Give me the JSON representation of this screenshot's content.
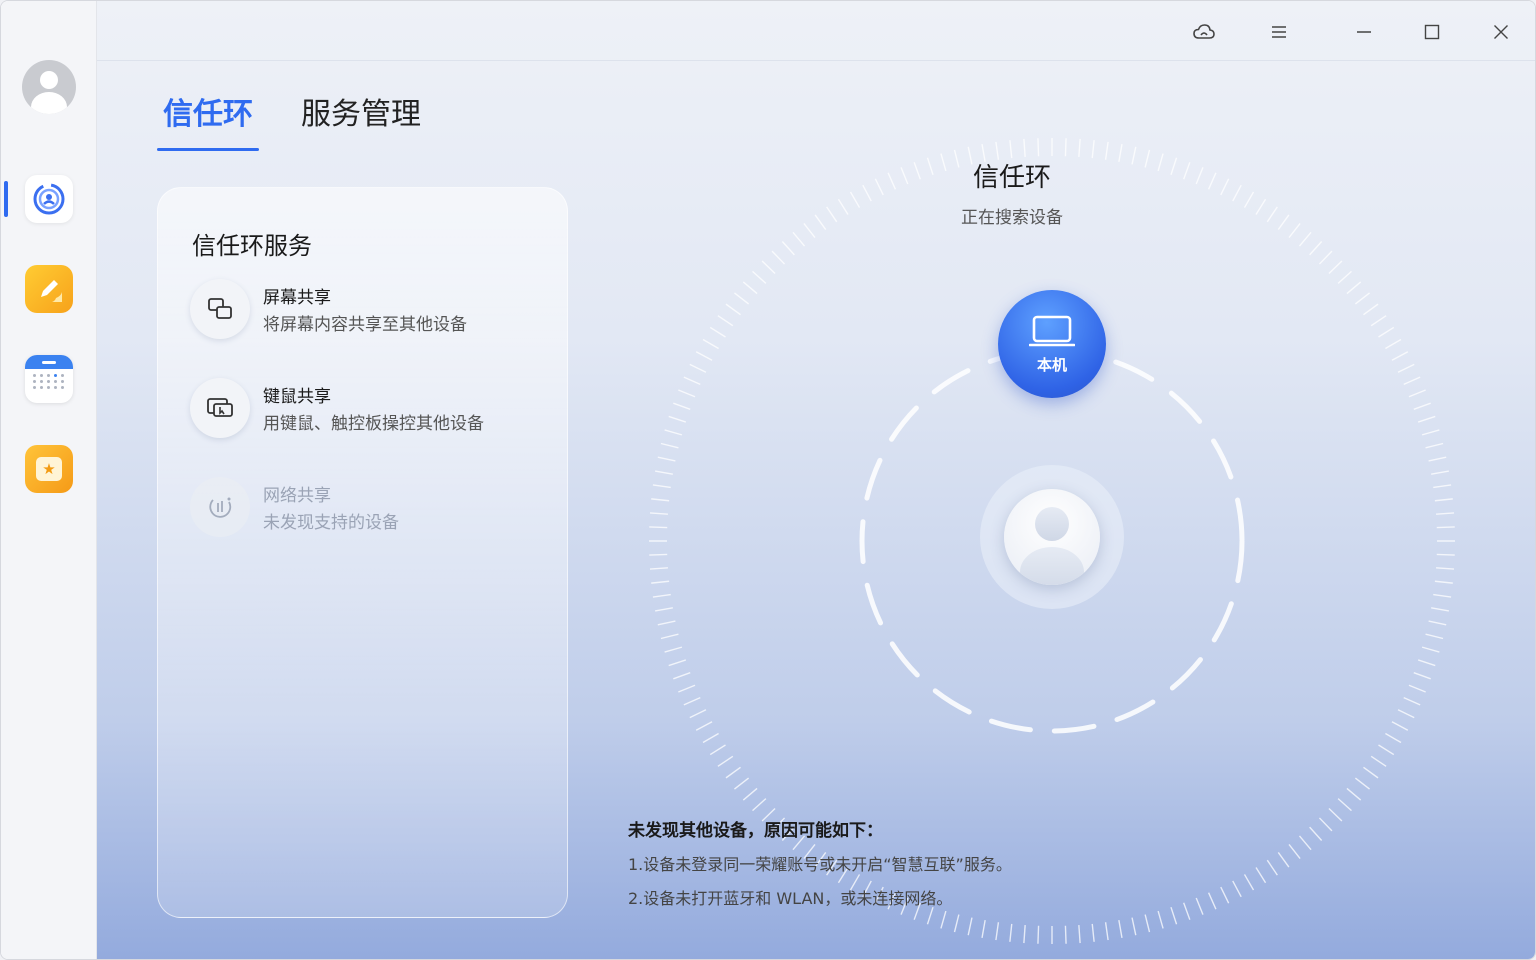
{
  "tabs": [
    {
      "label": "信任环",
      "active": true
    },
    {
      "label": "服务管理",
      "active": false
    }
  ],
  "card": {
    "title": "信任环服务",
    "services": [
      {
        "name": "屏幕共享",
        "desc": "将屏幕内容共享至其他设备",
        "icon": "screen-share-icon",
        "enabled": true
      },
      {
        "name": "键鼠共享",
        "desc": "用键鼠、触控板操控其他设备",
        "icon": "keyboard-mouse-share-icon",
        "enabled": true
      },
      {
        "name": "网络共享",
        "desc": "未发现支持的设备",
        "icon": "network-share-icon",
        "enabled": false
      }
    ]
  },
  "ring": {
    "title": "信任环",
    "status": "正在搜索设备",
    "local_device_label": "本机"
  },
  "notice": {
    "title": "未发现其他设备，原因可能如下：",
    "lines": [
      "1.设备未登录同一荣耀账号或未开启“智慧互联”服务。",
      "2.设备未打开蓝牙和 WLAN，或未连接网络。"
    ]
  },
  "colors": {
    "accent": "#2f6bf0",
    "local_device": "#2f63e6"
  }
}
